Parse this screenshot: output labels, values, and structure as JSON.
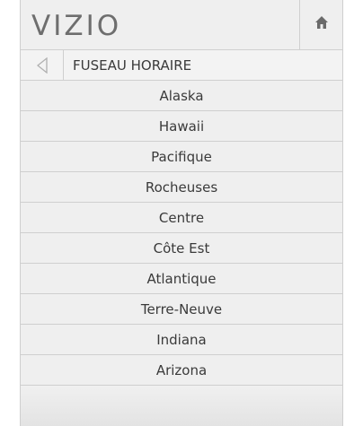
{
  "header": {
    "brand": "VIZIO",
    "home_icon": "home-icon"
  },
  "menu": {
    "title": "FUSEAU HORAIRE",
    "back_icon": "back-triangle-icon"
  },
  "items": [
    "Alaska",
    "Hawaii",
    "Pacifique",
    "Rocheuses",
    "Centre",
    "Côte Est",
    "Atlantique",
    "Terre-Neuve",
    "Indiana",
    "Arizona"
  ]
}
